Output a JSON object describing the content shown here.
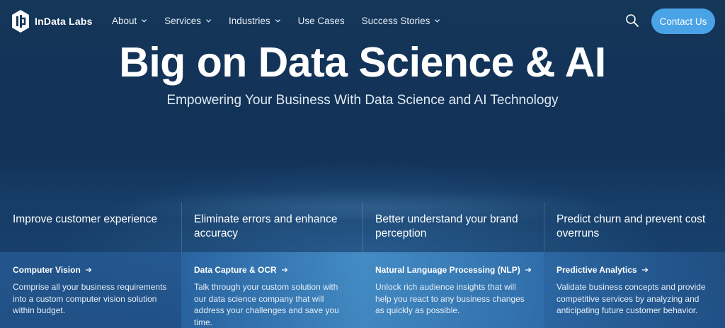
{
  "brand": {
    "name": "InData Labs",
    "icon": "indata-logo-icon"
  },
  "nav": {
    "items": [
      {
        "label": "About",
        "has_dropdown": true
      },
      {
        "label": "Services",
        "has_dropdown": true
      },
      {
        "label": "Industries",
        "has_dropdown": true
      },
      {
        "label": "Use Cases",
        "has_dropdown": false
      },
      {
        "label": "Success Stories",
        "has_dropdown": true
      }
    ],
    "search_icon": "search-icon",
    "contact_label": "Contact Us"
  },
  "hero": {
    "title": "Big on Data Science & AI",
    "subtitle": "Empowering Your Business With Data Science and AI Technology"
  },
  "cards": [
    {
      "heading": "Improve customer experience",
      "link": "Computer Vision",
      "description": "Comprise all your business requirements into a custom computer vision solution within budget."
    },
    {
      "heading": "Eliminate errors and enhance accuracy",
      "link": "Data Capture & OCR",
      "description": "Talk through your custom solution with our data science company that will address your challenges and save you time."
    },
    {
      "heading": "Better understand your brand perception",
      "link": "Natural Language Processing (NLP)",
      "description": "Unlock rich audience insights that will help you react to any business changes as quickly as possible."
    },
    {
      "heading": "Predict churn and prevent cost overruns",
      "link": "Predictive Analytics",
      "description": "Validate business concepts and provide competitive services by analyzing and anticipating future customer behavior."
    }
  ],
  "colors": {
    "background": "#143659",
    "accent": "#4aa3e6",
    "text": "#ffffff"
  }
}
